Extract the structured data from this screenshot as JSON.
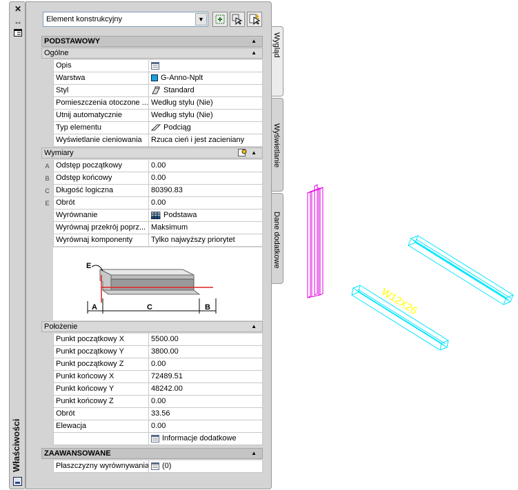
{
  "palette": {
    "title": "Właściwości",
    "object_type": "Element konstrukcyjny",
    "tabs": [
      "Wygląd",
      "Wyświetlanie",
      "Dane dodatkowe"
    ]
  },
  "basic": {
    "title": "PODSTAWOWY",
    "general": {
      "title": "Ogólne",
      "rows": [
        {
          "label": "Opis",
          "value": ""
        },
        {
          "label": "Warstwa",
          "value": "G-Anno-Nplt"
        },
        {
          "label": "Styl",
          "value": "Standard"
        },
        {
          "label": "Pomieszczenia otoczone ...",
          "value": "Według stylu (Nie)"
        },
        {
          "label": "Utnij automatycznie",
          "value": "Według stylu (Nie)"
        },
        {
          "label": "Typ elementu",
          "value": "Podciąg"
        },
        {
          "label": "Wyświetlanie cieniowania",
          "value": "Rzuca cień i jest zacieniany"
        }
      ]
    },
    "dimensions": {
      "title": "Wymiary",
      "rows": [
        {
          "key": "A",
          "label": "Odstęp początkowy",
          "value": "0.00"
        },
        {
          "key": "B",
          "label": "Odstęp końcowy",
          "value": "0.00"
        },
        {
          "key": "C",
          "label": "Długość logiczna",
          "value": "80390.83"
        },
        {
          "key": "E",
          "label": "Obrót",
          "value": "0.00"
        },
        {
          "key": "",
          "label": "Wyrównanie",
          "value": "Podstawa"
        },
        {
          "key": "",
          "label": "Wyrównaj przekrój poprz...",
          "value": "Maksimum"
        },
        {
          "key": "",
          "label": "Wyrównaj komponenty",
          "value": "Tylko najwyższy priorytet"
        }
      ],
      "diagram_labels": {
        "e": "E",
        "a": "A",
        "c": "C",
        "b": "B"
      }
    },
    "location": {
      "title": "Położenie",
      "rows": [
        {
          "label": "Punkt początkowy X",
          "value": "5500.00"
        },
        {
          "label": "Punkt początkowy Y",
          "value": "3800.00"
        },
        {
          "label": "Punkt początkowy Z",
          "value": "0.00"
        },
        {
          "label": "Punkt końcowy X",
          "value": "72489.51"
        },
        {
          "label": "Punkt końcowy Y",
          "value": "48242.00"
        },
        {
          "label": "Punkt końcowy Z",
          "value": "0.00"
        },
        {
          "label": "Obrót",
          "value": "33.56"
        },
        {
          "label": "Elewacja",
          "value": "0.00"
        },
        {
          "label": "",
          "value": "Informacje dodatkowe"
        }
      ]
    }
  },
  "advanced": {
    "title": "ZAAWANSOWANE",
    "rows": [
      {
        "label": "Płaszczyzny wyrównywania",
        "value": "(0)"
      }
    ]
  },
  "drawing": {
    "beam_label": "W12X26",
    "colors": {
      "column": "#e100e1",
      "beam": "#00e5ff",
      "label": "#ffff00"
    }
  }
}
